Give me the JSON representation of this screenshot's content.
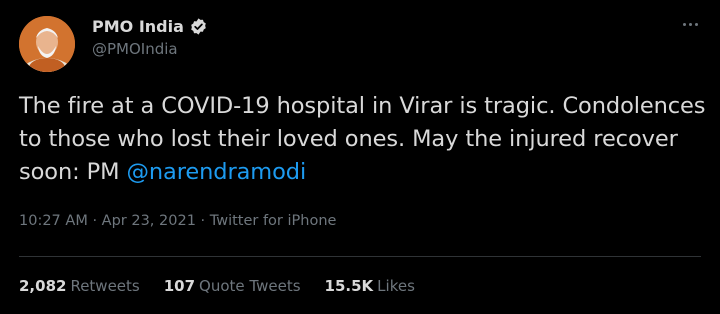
{
  "user": {
    "display_name": "PMO India",
    "handle": "@PMOIndia",
    "verified": true
  },
  "tweet": {
    "text_part1": "The fire at a COVID-19 hospital in Virar is tragic. Condolences to those who lost their loved ones. May the injured recover soon: PM ",
    "mention": "@narendramodi",
    "time": "10:27 AM",
    "separator": "·",
    "date": "Apr 23, 2021",
    "source": "Twitter for iPhone"
  },
  "stats": {
    "retweets_count": "2,082",
    "retweets_label": "Retweets",
    "quote_count": "107",
    "quote_label": "Quote Tweets",
    "likes_count": "15.5K",
    "likes_label": "Likes"
  },
  "colors": {
    "background": "#000000",
    "text": "#d9d9d9",
    "secondary": "#6e767d",
    "link": "#1d9bf0"
  },
  "icons": {
    "verified": "verified-badge-icon",
    "more": "more-options-icon"
  }
}
